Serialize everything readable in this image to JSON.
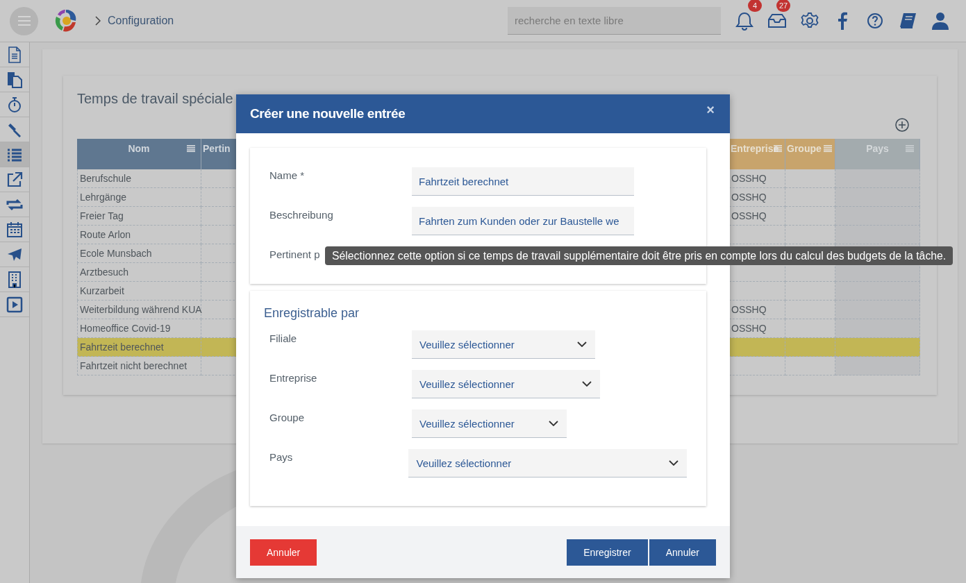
{
  "topbar": {
    "breadcrumb": "Configuration",
    "search": {
      "placeholder": "recherche en texte libre"
    },
    "notifications": {
      "count": "4"
    },
    "messages": {
      "count": "27"
    }
  },
  "sidebar": {
    "items": [
      {
        "selected": false
      },
      {
        "selected": false
      },
      {
        "selected": false
      },
      {
        "selected": false
      },
      {
        "selected": true
      },
      {
        "selected": false
      },
      {
        "selected": false
      },
      {
        "selected": false
      },
      {
        "selected": false
      },
      {
        "selected": false
      },
      {
        "selected": false
      }
    ]
  },
  "panel": {
    "title": "Temps de travail spéciale",
    "table": {
      "columns": [
        "Nom",
        "Pertin",
        "Entreprise",
        "Groupe",
        "Pays"
      ],
      "rows": [
        {
          "name": "Berufschule",
          "entreprise": "OSSHQ",
          "selected": false
        },
        {
          "name": "Lehrgänge",
          "entreprise": "OSSHQ",
          "selected": false
        },
        {
          "name": "Freier Tag",
          "entreprise": "OSSHQ",
          "selected": false
        },
        {
          "name": "Route Arlon",
          "entreprise": "",
          "selected": false
        },
        {
          "name": "Ecole Munsbach",
          "entreprise": "",
          "selected": false
        },
        {
          "name": "Arztbesuch",
          "entreprise": "",
          "selected": false
        },
        {
          "name": "Kurzarbeit",
          "entreprise": "",
          "selected": false
        },
        {
          "name": "Weiterbildung während KUA",
          "entreprise": "OSSHQ",
          "selected": false
        },
        {
          "name": "Homeoffice Covid-19",
          "entreprise": "OSSHQ",
          "selected": false
        },
        {
          "name": "Fahrtzeit berechnet",
          "entreprise": "",
          "selected": true
        },
        {
          "name": "Fahrtzeit nicht berechnet",
          "entreprise": "",
          "selected": false
        }
      ]
    }
  },
  "dialog": {
    "title": "Créer une nouvelle entrée",
    "close": "×",
    "fields": [
      {
        "label": "Name *",
        "value": "Fahrtzeit berechnet"
      },
      {
        "label": "Beschreibung",
        "value": "Fahrten zum Kunden oder zur Baustelle we"
      }
    ],
    "partial_label": "Pertinent p",
    "tooltip": "Sélectionnez cette option si ce temps de travail supplémentaire doit être pris en compte lors du calcul des budgets de la tâche.",
    "section_title": "Enregistrable par",
    "selects": [
      {
        "label": "Filiale",
        "value": "Veuillez sélectionner"
      },
      {
        "label": "Entreprise",
        "value": "Veuillez sélectionner"
      },
      {
        "label": "Groupe",
        "value": "Veuillez sélectionner"
      },
      {
        "label": "Pays",
        "value": "Veuillez sélectionner"
      }
    ],
    "buttons": {
      "cancel_left": "Annuler",
      "save": "Enregistrer",
      "cancel_right": "Annuler"
    }
  }
}
